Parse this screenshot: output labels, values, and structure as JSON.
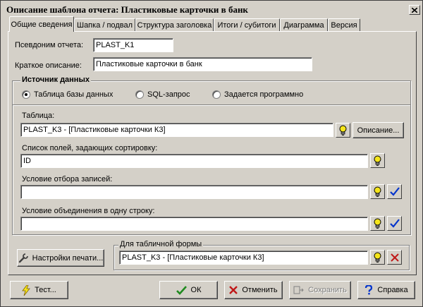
{
  "window": {
    "title": "Описание шаблона отчета: Пластиковые карточки в банк"
  },
  "tabs": [
    {
      "label": "Общие сведения"
    },
    {
      "label": "Шапка / подвал"
    },
    {
      "label": "Структура заголовка"
    },
    {
      "label": "Итоги / субитоги"
    },
    {
      "label": "Диаграмма"
    },
    {
      "label": "Версия"
    }
  ],
  "general": {
    "alias_label": "Псевдоним отчета:",
    "alias_value": "PLAST_K1",
    "desc_label": "Краткое описание:",
    "desc_value": "Пластиковые карточки в банк"
  },
  "source": {
    "group_title": "Источник данных",
    "options": [
      {
        "label": "Таблица базы данных",
        "selected": true
      },
      {
        "label": "SQL-запрос",
        "selected": false
      },
      {
        "label": "Задается программно",
        "selected": false
      }
    ],
    "table_label": "Таблица:",
    "table_value": "PLAST_K3 - [Пластиковые карточки К3]",
    "description_button": "Описание...",
    "sort_label": "Список полей, задающих сортировку:",
    "sort_value": "ID",
    "filter_label": "Условие отбора записей:",
    "filter_value": "",
    "merge_label": "Условие объединения в одну строку:",
    "merge_value": ""
  },
  "print_settings_button": "Настройки печати...",
  "table_form": {
    "group_title": "Для табличной формы",
    "value": "PLAST_K3 - [Пластиковые карточки К3]"
  },
  "footer": {
    "test": "Тест...",
    "ok": "ОК",
    "cancel": "Отменить",
    "save": "Сохранить",
    "help": "Справка"
  },
  "icons": {
    "lightbulb": "lightbulb-icon",
    "check": "checkmark-icon",
    "delete": "red-x-icon",
    "wrench": "wrench-icon",
    "lightning": "lightning-icon",
    "help": "question-icon",
    "save": "save-icon",
    "cancel": "cancel-x-icon"
  },
  "colors": {
    "face": "#d4d0c8",
    "check": "#0033cc",
    "ok": "#1f8a1f",
    "cancel": "#c01818",
    "bulb": "#f5e51a"
  }
}
